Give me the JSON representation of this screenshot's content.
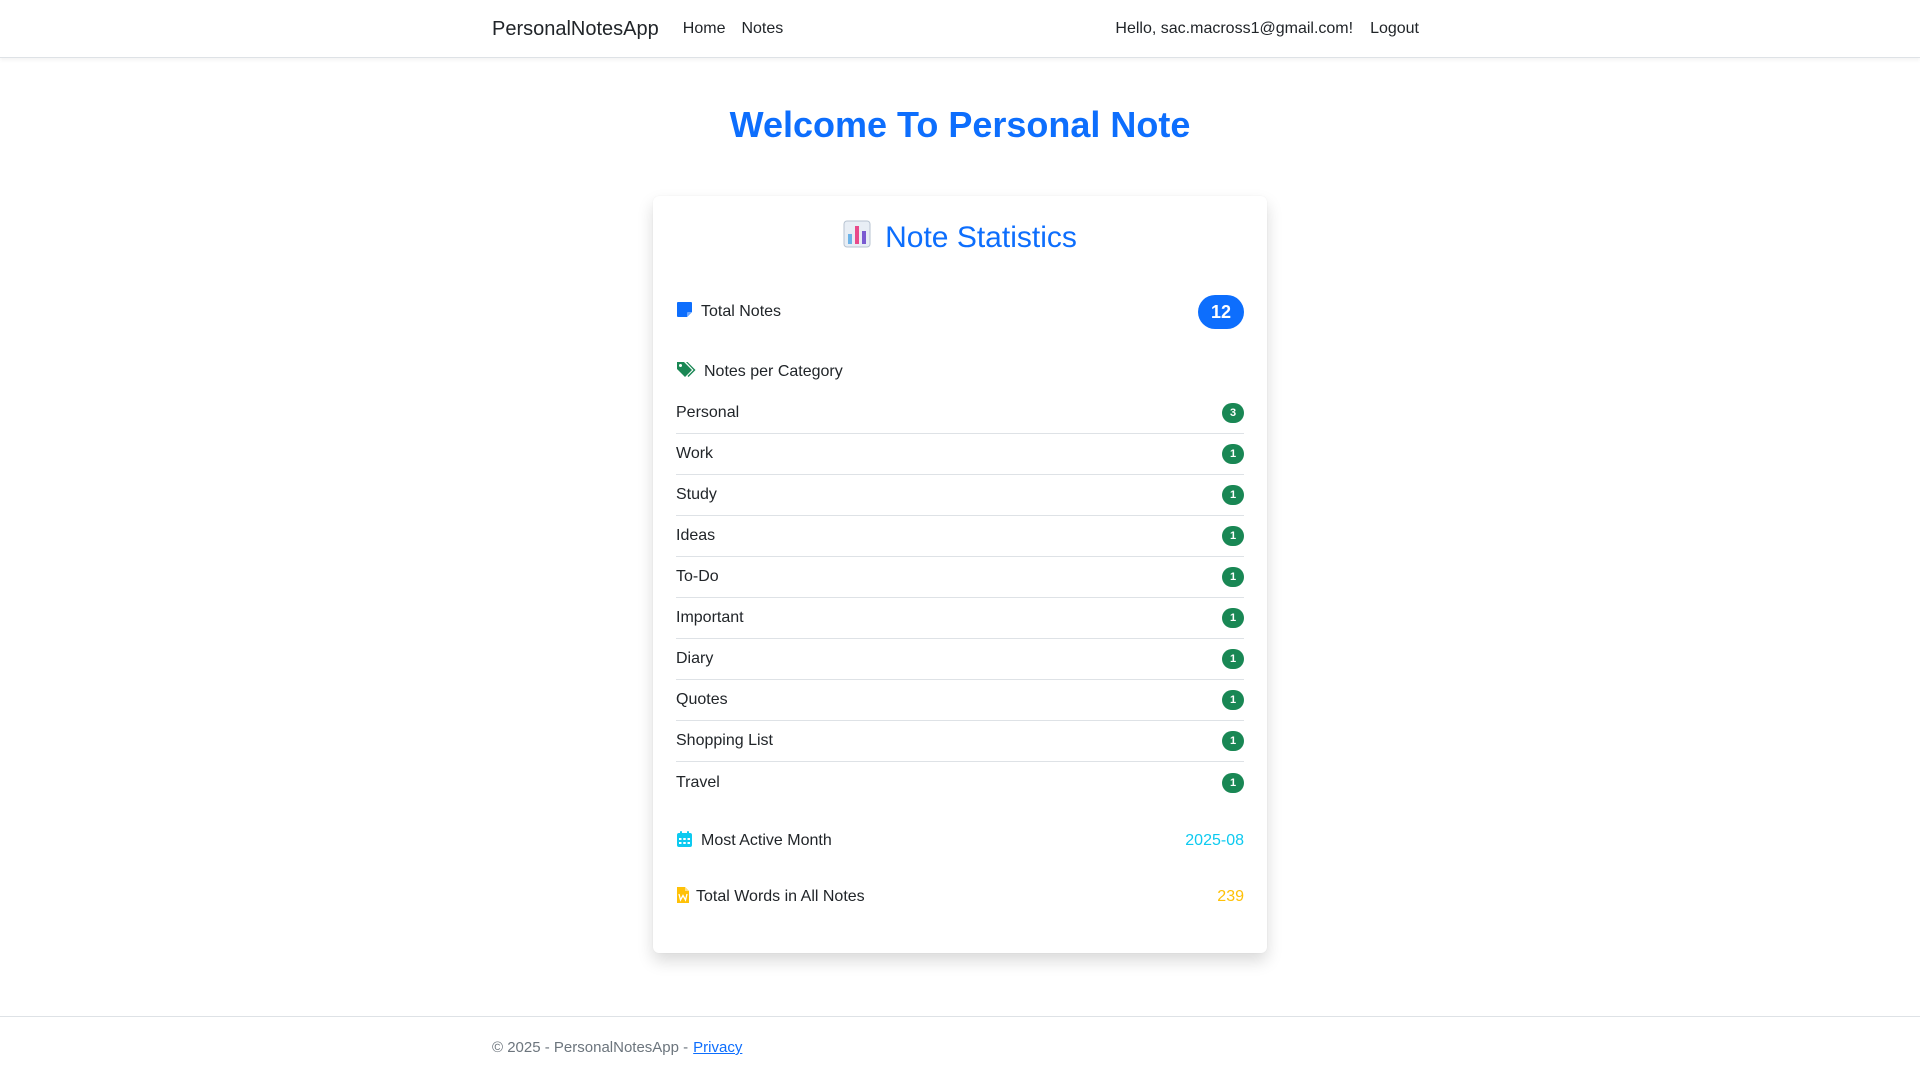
{
  "navbar": {
    "brand": "PersonalNotesApp",
    "links": [
      "Home",
      "Notes"
    ],
    "greeting": "Hello, sac.macross1@gmail.com!",
    "logout": "Logout"
  },
  "welcome": "Welcome To Personal Note",
  "stats": {
    "title": "Note Statistics",
    "title_icon": "bar-chart-icon",
    "total_notes_label": "Total Notes",
    "total_notes_value": "12",
    "per_category_label": "Notes per Category",
    "categories": [
      {
        "name": "Personal",
        "count": "3"
      },
      {
        "name": "Work",
        "count": "1"
      },
      {
        "name": "Study",
        "count": "1"
      },
      {
        "name": "Ideas",
        "count": "1"
      },
      {
        "name": "To-Do",
        "count": "1"
      },
      {
        "name": "Important",
        "count": "1"
      },
      {
        "name": "Diary",
        "count": "1"
      },
      {
        "name": "Quotes",
        "count": "1"
      },
      {
        "name": "Shopping List",
        "count": "1"
      },
      {
        "name": "Travel",
        "count": "1"
      }
    ],
    "most_active_label": "Most Active Month",
    "most_active_value": "2025-08",
    "total_words_label": "Total Words in All Notes",
    "total_words_value": "239"
  },
  "colors": {
    "primary": "#0d6efd",
    "success": "#198754",
    "info": "#0dcaf0",
    "warning": "#ffc107"
  },
  "footer": {
    "copyright": "© 2025 - PersonalNotesApp -",
    "privacy": "Privacy"
  }
}
